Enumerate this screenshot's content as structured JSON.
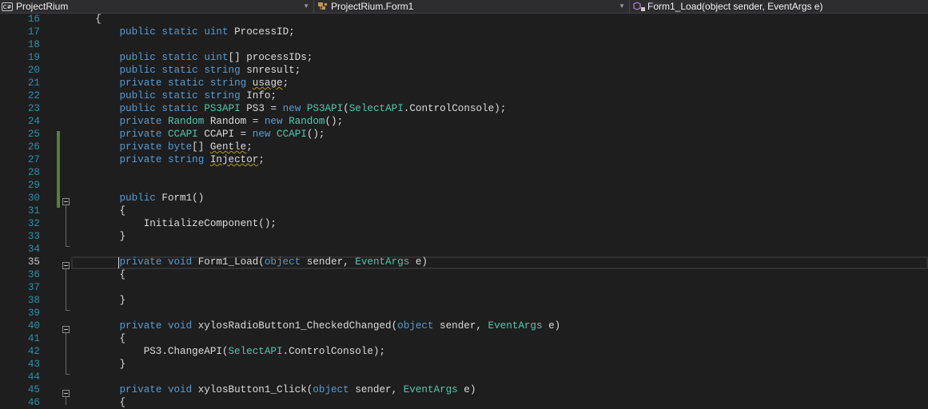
{
  "nav": {
    "project": {
      "icon": "csharp-project-icon",
      "badge": "C#",
      "label": "ProjectRium"
    },
    "type": {
      "icon": "class-icon",
      "label": "ProjectRium.Form1"
    },
    "member": {
      "icon": "method-icon",
      "label": "Form1_Load(object sender, EventArgs e)"
    }
  },
  "colors": {
    "keyword": "#569cd6",
    "type": "#4ec9b0",
    "line_number": "#2b91af",
    "text": "#dcdcdc",
    "background": "#1e1e1e",
    "change_bar": "#57803a"
  },
  "editor": {
    "current_line": "35",
    "lines": [
      {
        "n": "16",
        "parts": [
          [
            "p",
            "    {"
          ]
        ]
      },
      {
        "n": "17",
        "parts": [
          [
            "p",
            "        "
          ],
          [
            "k",
            "public"
          ],
          [
            "p",
            " "
          ],
          [
            "k",
            "static"
          ],
          [
            "p",
            " "
          ],
          [
            "k",
            "uint"
          ],
          [
            "p",
            " ProcessID;"
          ]
        ]
      },
      {
        "n": "18",
        "parts": []
      },
      {
        "n": "19",
        "parts": [
          [
            "p",
            "        "
          ],
          [
            "k",
            "public"
          ],
          [
            "p",
            " "
          ],
          [
            "k",
            "static"
          ],
          [
            "p",
            " "
          ],
          [
            "k",
            "uint"
          ],
          [
            "p",
            "[] processIDs;"
          ]
        ]
      },
      {
        "n": "20",
        "parts": [
          [
            "p",
            "        "
          ],
          [
            "k",
            "public"
          ],
          [
            "p",
            " "
          ],
          [
            "k",
            "static"
          ],
          [
            "p",
            " "
          ],
          [
            "k",
            "string"
          ],
          [
            "p",
            " snresult;"
          ]
        ]
      },
      {
        "n": "21",
        "parts": [
          [
            "p",
            "        "
          ],
          [
            "k",
            "private"
          ],
          [
            "p",
            " "
          ],
          [
            "k",
            "static"
          ],
          [
            "p",
            " "
          ],
          [
            "k",
            "string"
          ],
          [
            "p",
            " "
          ],
          [
            "s",
            "usage"
          ],
          [
            "p",
            ";"
          ]
        ]
      },
      {
        "n": "22",
        "parts": [
          [
            "p",
            "        "
          ],
          [
            "k",
            "public"
          ],
          [
            "p",
            " "
          ],
          [
            "k",
            "static"
          ],
          [
            "p",
            " "
          ],
          [
            "k",
            "string"
          ],
          [
            "p",
            " Info;"
          ]
        ]
      },
      {
        "n": "23",
        "parts": [
          [
            "p",
            "        "
          ],
          [
            "k",
            "public"
          ],
          [
            "p",
            " "
          ],
          [
            "k",
            "static"
          ],
          [
            "p",
            " "
          ],
          [
            "t",
            "PS3API"
          ],
          [
            "p",
            " PS3 = "
          ],
          [
            "k",
            "new"
          ],
          [
            "p",
            " "
          ],
          [
            "t",
            "PS3API"
          ],
          [
            "p",
            "("
          ],
          [
            "t",
            "SelectAPI"
          ],
          [
            "p",
            ".ControlConsole);"
          ]
        ]
      },
      {
        "n": "24",
        "parts": [
          [
            "p",
            "        "
          ],
          [
            "k",
            "private"
          ],
          [
            "p",
            " "
          ],
          [
            "t",
            "Random"
          ],
          [
            "p",
            " Random = "
          ],
          [
            "k",
            "new"
          ],
          [
            "p",
            " "
          ],
          [
            "t",
            "Random"
          ],
          [
            "p",
            "();"
          ]
        ]
      },
      {
        "n": "25",
        "parts": [
          [
            "p",
            "        "
          ],
          [
            "k",
            "private"
          ],
          [
            "p",
            " "
          ],
          [
            "t",
            "CCAPI"
          ],
          [
            "p",
            " CCAPI = "
          ],
          [
            "k",
            "new"
          ],
          [
            "p",
            " "
          ],
          [
            "t",
            "CCAPI"
          ],
          [
            "p",
            "();"
          ]
        ]
      },
      {
        "n": "26",
        "parts": [
          [
            "p",
            "        "
          ],
          [
            "k",
            "private"
          ],
          [
            "p",
            " "
          ],
          [
            "k",
            "byte"
          ],
          [
            "p",
            "[] "
          ],
          [
            "s",
            "Gentle"
          ],
          [
            "p",
            ";"
          ]
        ]
      },
      {
        "n": "27",
        "parts": [
          [
            "p",
            "        "
          ],
          [
            "k",
            "private"
          ],
          [
            "p",
            " "
          ],
          [
            "k",
            "string"
          ],
          [
            "p",
            " "
          ],
          [
            "s",
            "Injector"
          ],
          [
            "p",
            ";"
          ]
        ]
      },
      {
        "n": "28",
        "parts": []
      },
      {
        "n": "29",
        "parts": []
      },
      {
        "n": "30",
        "parts": [
          [
            "p",
            "        "
          ],
          [
            "k",
            "public"
          ],
          [
            "p",
            " Form1()"
          ]
        ]
      },
      {
        "n": "31",
        "parts": [
          [
            "p",
            "        {"
          ]
        ]
      },
      {
        "n": "32",
        "parts": [
          [
            "p",
            "            InitializeComponent();"
          ]
        ]
      },
      {
        "n": "33",
        "parts": [
          [
            "p",
            "        }"
          ]
        ]
      },
      {
        "n": "34",
        "parts": []
      },
      {
        "n": "35",
        "parts": [
          [
            "p",
            "        "
          ],
          [
            "k",
            "private"
          ],
          [
            "p",
            " "
          ],
          [
            "k",
            "void"
          ],
          [
            "p",
            " Form1_Load("
          ],
          [
            "k",
            "object"
          ],
          [
            "p",
            " sender, "
          ],
          [
            "t",
            "EventArgs"
          ],
          [
            "p",
            " e)"
          ]
        ]
      },
      {
        "n": "36",
        "parts": [
          [
            "p",
            "        {"
          ]
        ]
      },
      {
        "n": "37",
        "parts": []
      },
      {
        "n": "38",
        "parts": [
          [
            "p",
            "        }"
          ]
        ]
      },
      {
        "n": "39",
        "parts": []
      },
      {
        "n": "40",
        "parts": [
          [
            "p",
            "        "
          ],
          [
            "k",
            "private"
          ],
          [
            "p",
            " "
          ],
          [
            "k",
            "void"
          ],
          [
            "p",
            " xylosRadioButton1_CheckedChanged("
          ],
          [
            "k",
            "object"
          ],
          [
            "p",
            " sender, "
          ],
          [
            "t",
            "EventArgs"
          ],
          [
            "p",
            " e)"
          ]
        ]
      },
      {
        "n": "41",
        "parts": [
          [
            "p",
            "        {"
          ]
        ]
      },
      {
        "n": "42",
        "parts": [
          [
            "p",
            "            PS3.ChangeAPI("
          ],
          [
            "t",
            "SelectAPI"
          ],
          [
            "p",
            ".ControlConsole);"
          ]
        ]
      },
      {
        "n": "43",
        "parts": [
          [
            "p",
            "        }"
          ]
        ]
      },
      {
        "n": "44",
        "parts": []
      },
      {
        "n": "45",
        "parts": [
          [
            "p",
            "        "
          ],
          [
            "k",
            "private"
          ],
          [
            "p",
            " "
          ],
          [
            "k",
            "void"
          ],
          [
            "p",
            " xylosButton1_Click("
          ],
          [
            "k",
            "object"
          ],
          [
            "p",
            " sender, "
          ],
          [
            "t",
            "EventArgs"
          ],
          [
            "p",
            " e)"
          ]
        ]
      },
      {
        "n": "46",
        "parts": [
          [
            "p",
            "        {"
          ]
        ]
      }
    ]
  }
}
